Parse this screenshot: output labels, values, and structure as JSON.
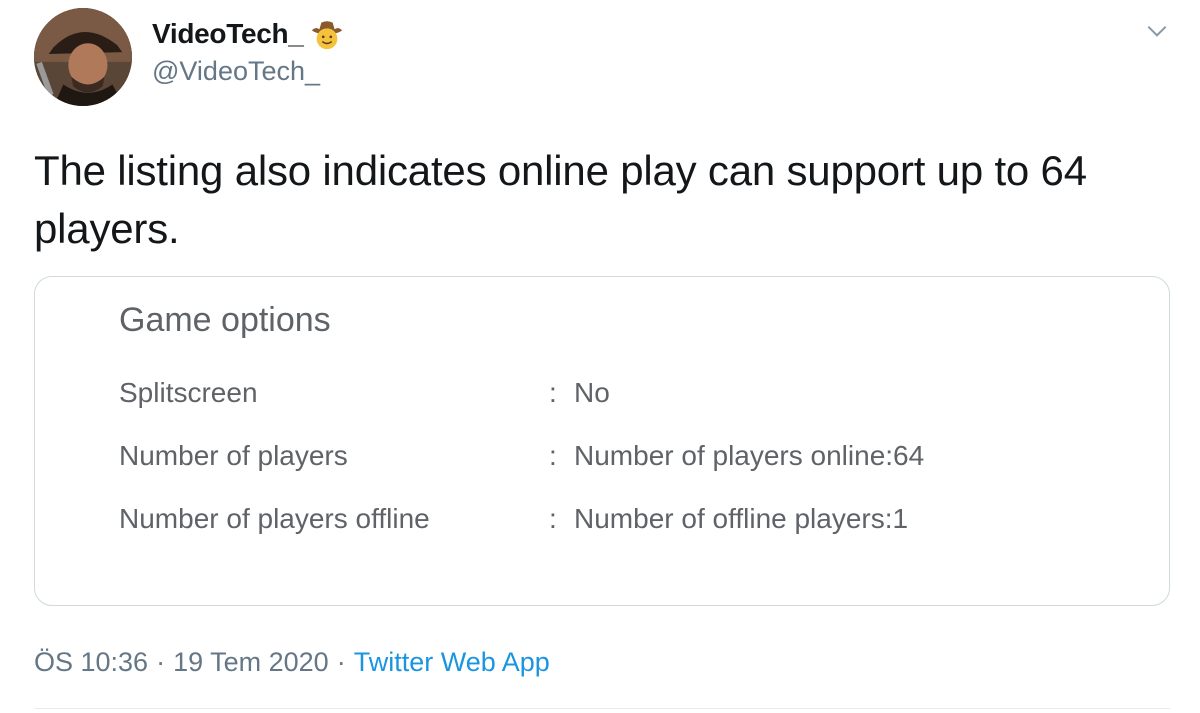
{
  "author": {
    "display_name": "VideoTech_",
    "emoji_icon": "cowboy-hat-face-icon",
    "handle": "@VideoTech_",
    "avatar_icon": "avatar-image"
  },
  "tweet": {
    "text": "The listing also indicates online play can support up to 64 players."
  },
  "card": {
    "title": "Game options",
    "rows": [
      {
        "label": "Splitscreen",
        "separator": ":",
        "value": "No"
      },
      {
        "label": "Number of players",
        "separator": ":",
        "value": "Number of players online:64"
      },
      {
        "label": "Number of players offline",
        "separator": ":",
        "value": "Number of offline players:1"
      }
    ]
  },
  "meta": {
    "time": "ÖS 10:36",
    "dot1": "·",
    "date": "19 Tem 2020",
    "dot2": "·",
    "source": "Twitter Web App"
  },
  "colors": {
    "text": "#14171a",
    "secondary": "#657786",
    "link": "#1b95e0",
    "card_border": "#cfd9de",
    "card_text": "#5f6368"
  },
  "icons": {
    "menu": "chevron-down-icon"
  }
}
